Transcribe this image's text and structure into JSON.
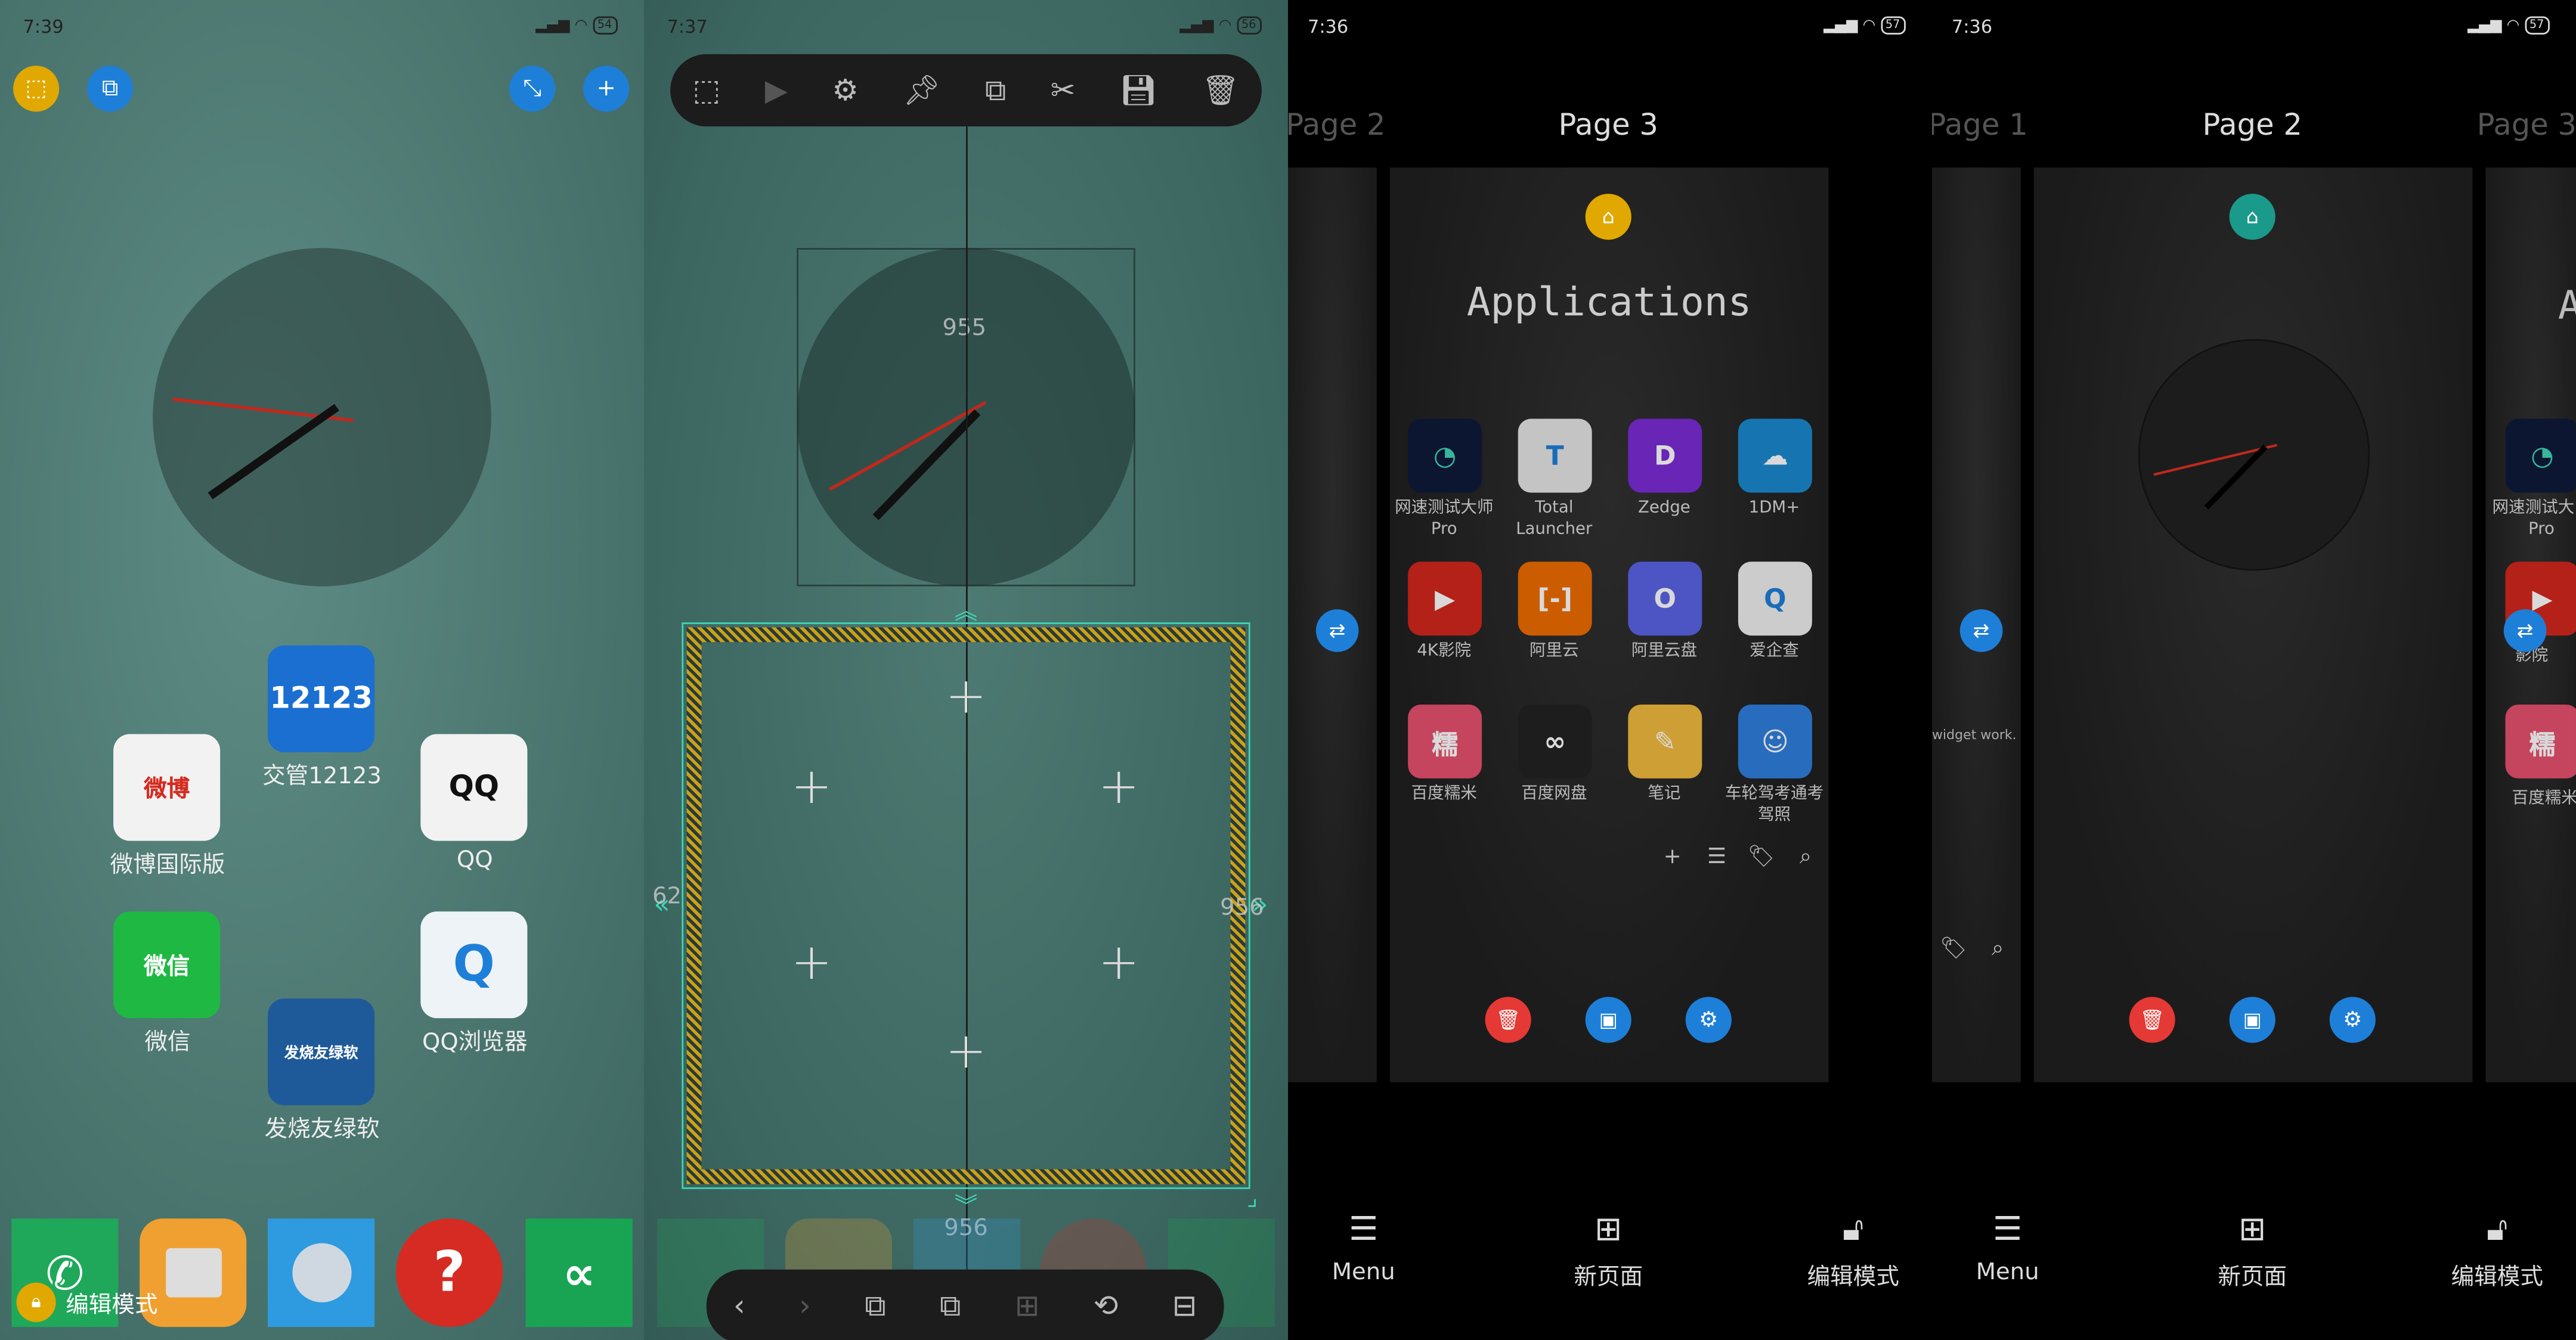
{
  "panel1": {
    "status": {
      "time": "7:39",
      "battery": "54"
    },
    "top_buttons": [
      {
        "icon": "select-icon",
        "color": "#e0a800"
      },
      {
        "icon": "resize-icon",
        "color": "#1e7fd8"
      },
      {
        "icon": "collapse-icon",
        "color": "#1e7fd8"
      },
      {
        "icon": "plus-icon",
        "color": "#1e7fd8"
      }
    ],
    "apps": [
      {
        "label": "交管12123",
        "badge": "12123"
      },
      {
        "label": "微博国际版",
        "badge": "微博"
      },
      {
        "label": "QQ",
        "badge": "QQ"
      },
      {
        "label": "微信",
        "badge": "微信"
      },
      {
        "label": "QQ浏览器",
        "badge": "Q"
      },
      {
        "label": "发烧友绿软",
        "badge": "发烧友绿软"
      }
    ],
    "dock": [
      "phone",
      "notes",
      "browser",
      "help",
      "app"
    ],
    "edit_mode_label": "编辑模式"
  },
  "panel2": {
    "status": {
      "time": "7:37",
      "battery": "56"
    },
    "toolbar": [
      "select-all-icon",
      "play-icon",
      "settings-icon",
      "pin-icon",
      "copy-icon",
      "cut-icon",
      "save-icon",
      "delete-icon"
    ],
    "clock_readout": "955",
    "left_readout": "62",
    "right_readout": "956",
    "bottom_readout": "956",
    "bottom_toolbar": [
      "back-icon",
      "forward-icon",
      "bring-forward-icon",
      "send-backward-icon",
      "fit-grid-icon",
      "rotate-icon",
      "align-center-icon"
    ]
  },
  "panel3": {
    "status": {
      "time": "7:36",
      "battery": "57"
    },
    "pages": {
      "prev": "Page 2",
      "current": "Page 3"
    },
    "drawer_title": "Applications",
    "apps": [
      {
        "label": "网速测试大师 Pro",
        "color": "#0e1a3a",
        "glyph": "◔"
      },
      {
        "label": "Total Launcher",
        "color": "#e6e6e6",
        "glyph": "T"
      },
      {
        "label": "Zedge",
        "color": "#7a2bd6",
        "glyph": "D"
      },
      {
        "label": "1DM+",
        "color": "#1a8ad0",
        "glyph": "☁"
      },
      {
        "label": "4K影院",
        "color": "#d4271d",
        "glyph": "▶"
      },
      {
        "label": "阿里云",
        "color": "#ef6c00",
        "glyph": "[-]"
      },
      {
        "label": "阿里云盘",
        "color": "#5b63e6",
        "glyph": "O"
      },
      {
        "label": "爱企查",
        "color": "#f0f0f0",
        "glyph": "Q"
      },
      {
        "label": "百度糯米",
        "color": "#e8506e",
        "glyph": "糯"
      },
      {
        "label": "百度网盘",
        "color": "#222222",
        "glyph": "∞"
      },
      {
        "label": "笔记",
        "color": "#f2bb3d",
        "glyph": "✎"
      },
      {
        "label": "车轮驾考通考驾照",
        "color": "#2f7fe0",
        "glyph": "☺"
      }
    ],
    "drawer_tools": [
      "add-icon",
      "sort-icon",
      "tag-icon",
      "search-icon"
    ],
    "actions": [
      {
        "icon": "delete-icon",
        "color": "#e53935"
      },
      {
        "icon": "wallpaper-icon",
        "color": "#1e7fd8"
      },
      {
        "icon": "settings-icon",
        "color": "#1e7fd8"
      }
    ],
    "nav": {
      "menu": "Menu",
      "new_page": "新页面",
      "edit_mode": "编辑模式"
    }
  },
  "panel4": {
    "status": {
      "time": "7:36",
      "battery": "57"
    },
    "pages": {
      "prev": "Page 1",
      "current": "Page 2",
      "next": "Page 3"
    },
    "left_card_text": "widget work.",
    "right_card_title": "A",
    "right_apps": [
      {
        "label": "网速测试大"
      },
      {
        "label": "Pro"
      },
      {
        "label": "影院"
      },
      {
        "label": "百度糯米"
      }
    ],
    "nav": {
      "menu": "Menu",
      "new_page": "新页面",
      "edit_mode": "编辑模式"
    }
  },
  "colors": {
    "accent_blue": "#1e7fd8",
    "accent_yellow": "#e0a800",
    "guide_teal": "#3fd6b6",
    "danger_red": "#e53935",
    "home_teal": "#1a9a8a"
  }
}
